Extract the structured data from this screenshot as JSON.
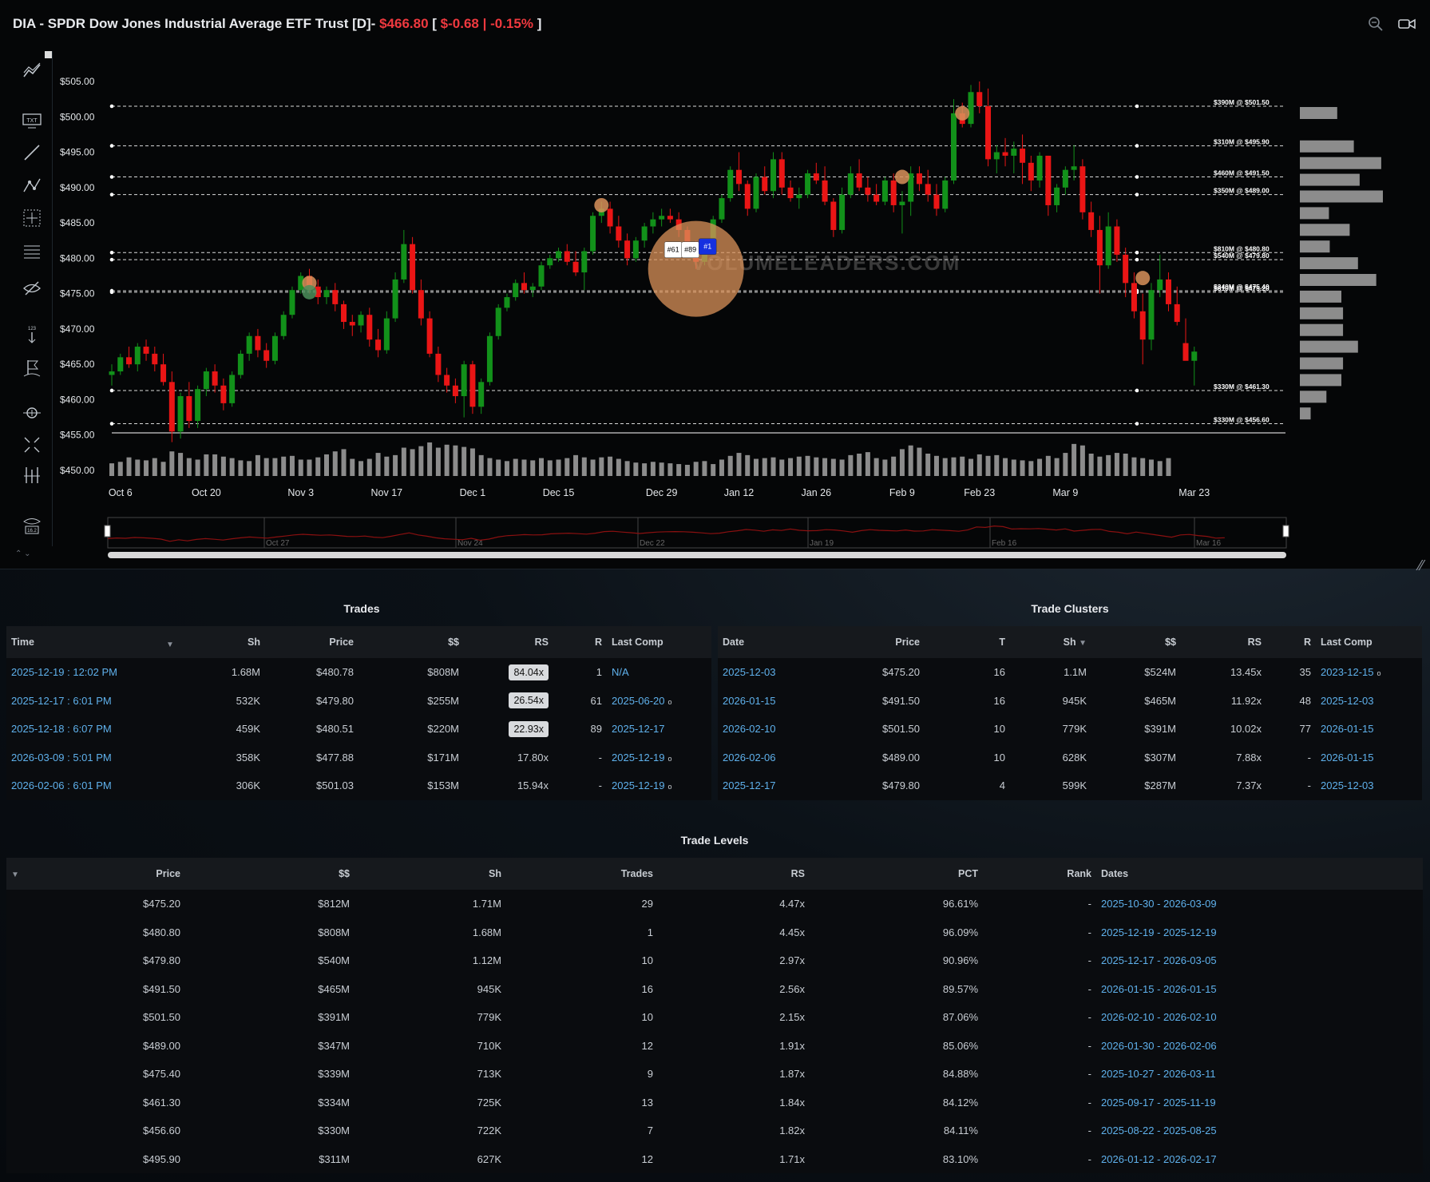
{
  "chart": {
    "title": "DIA - SPDR Dow Jones Industrial Average ETF Trust [D]-",
    "price": "$466.80",
    "change_open": "[",
    "change": "$-0.68 | -0.15%",
    "change_close": "]",
    "watermark": "VOLUMELEADERS.COM",
    "colors": {
      "up": "#12911a",
      "down": "#ea1515",
      "level": "#ffffff",
      "volume": "#8c8c8c",
      "bubble": "#d9925a",
      "accent_red": "#f0393f",
      "link": "#5fb1ec"
    }
  },
  "toolbar": {
    "icons": [
      "indicators-icon",
      "text-icon",
      "line-icon",
      "pattern-icon",
      "crosshair-box-icon",
      "fib-icon",
      "hide-icon",
      "measure-icon",
      "flag-icon",
      "zoom-icon",
      "fullscreen-icon",
      "levels-icon",
      "eye-count-icon"
    ],
    "eye_count": "16.2"
  },
  "chart_data": {
    "type": "candlestick",
    "y_ticks": [
      "$505.00",
      "$500.00",
      "$495.00",
      "$490.00",
      "$485.00",
      "$480.00",
      "$475.00",
      "$470.00",
      "$465.00",
      "$460.00",
      "$455.00",
      "$450.00"
    ],
    "ylim": [
      450,
      505
    ],
    "x_ticks": [
      {
        "label": "Oct 6",
        "i": 1
      },
      {
        "label": "Oct 20",
        "i": 11
      },
      {
        "label": "Nov 3",
        "i": 22
      },
      {
        "label": "Nov 17",
        "i": 32
      },
      {
        "label": "Dec 1",
        "i": 42
      },
      {
        "label": "Dec 15",
        "i": 52
      },
      {
        "label": "Dec 29",
        "i": 64
      },
      {
        "label": "Jan 12",
        "i": 73
      },
      {
        "label": "Jan 26",
        "i": 82
      },
      {
        "label": "Feb 9",
        "i": 92
      },
      {
        "label": "Feb 23",
        "i": 101
      },
      {
        "label": "Mar 9",
        "i": 111
      },
      {
        "label": "Mar 23",
        "i": 126
      }
    ],
    "candles": [
      [
        463.5,
        465,
        462,
        464
      ],
      [
        464,
        466.5,
        463.5,
        466
      ],
      [
        466,
        467.5,
        464.5,
        465
      ],
      [
        465,
        468,
        464,
        467.5
      ],
      [
        467.5,
        468.5,
        465.5,
        466.5
      ],
      [
        466.5,
        467.5,
        464,
        465
      ],
      [
        465,
        466.5,
        462,
        462.5
      ],
      [
        462.5,
        464,
        454,
        455.5
      ],
      [
        455.5,
        461,
        454.5,
        460.5
      ],
      [
        460.5,
        462.5,
        456,
        457
      ],
      [
        457,
        462,
        456,
        461.5
      ],
      [
        461.5,
        464.5,
        460.5,
        464
      ],
      [
        464,
        465,
        461,
        462
      ],
      [
        462,
        463,
        458.5,
        459.5
      ],
      [
        459.5,
        464,
        459,
        463.5
      ],
      [
        463.5,
        467,
        463,
        466.5
      ],
      [
        466.5,
        469.5,
        465.5,
        469
      ],
      [
        469,
        470,
        466,
        467
      ],
      [
        467,
        468,
        464.5,
        465.5
      ],
      [
        465.5,
        469.5,
        465,
        469
      ],
      [
        469,
        472.5,
        468.5,
        472
      ],
      [
        472,
        476,
        471.5,
        475.5
      ],
      [
        475.5,
        478,
        475,
        477.5
      ],
      [
        477.5,
        478.5,
        475,
        476
      ],
      [
        476,
        477,
        473.5,
        474.5
      ],
      [
        474.5,
        476,
        473.5,
        475.5
      ],
      [
        475.5,
        476.5,
        472.5,
        473.5
      ],
      [
        473.5,
        474,
        470,
        471
      ],
      [
        471,
        472,
        469,
        470.5
      ],
      [
        470.5,
        472.5,
        469.5,
        472
      ],
      [
        472,
        473,
        467.5,
        468.5
      ],
      [
        468.5,
        470,
        466,
        467
      ],
      [
        467,
        472.5,
        466.5,
        471.5
      ],
      [
        471.5,
        478,
        471,
        477
      ],
      [
        477,
        484,
        476.5,
        482
      ],
      [
        482,
        483,
        475,
        475.5
      ],
      [
        475.5,
        477,
        470.5,
        471.5
      ],
      [
        471.5,
        472.5,
        466,
        466.5
      ],
      [
        466.5,
        467.5,
        462.5,
        463.5
      ],
      [
        463.5,
        464.5,
        461,
        462
      ],
      [
        462,
        463,
        459.5,
        460.5
      ],
      [
        460.5,
        465.5,
        457.5,
        465
      ],
      [
        465,
        465.5,
        458,
        459
      ],
      [
        459,
        463,
        458,
        462.5
      ],
      [
        462.5,
        469.5,
        462,
        469
      ],
      [
        469,
        473.5,
        468.5,
        473
      ],
      [
        473,
        475,
        472.5,
        474.5
      ],
      [
        474.5,
        477,
        474,
        476.5
      ],
      [
        476.5,
        478,
        475,
        475.5
      ],
      [
        475.5,
        476.5,
        474.5,
        476
      ],
      [
        476,
        479.5,
        475.5,
        479
      ],
      [
        479,
        480.5,
        478.5,
        480
      ],
      [
        480,
        481.5,
        479.5,
        481
      ],
      [
        481,
        482,
        479,
        479.5
      ],
      [
        479.5,
        481,
        477.5,
        478
      ],
      [
        478,
        481.5,
        475.5,
        481
      ],
      [
        481,
        486.5,
        480.5,
        486
      ],
      [
        486,
        488,
        485,
        487
      ],
      [
        487,
        488,
        483.5,
        484.5
      ],
      [
        484.5,
        486,
        481.5,
        482.5
      ],
      [
        482.5,
        483.5,
        479,
        480
      ],
      [
        480,
        483,
        479.5,
        482.5
      ],
      [
        482.5,
        485,
        481.5,
        484.5
      ],
      [
        484.5,
        486.5,
        483.5,
        485.5
      ],
      [
        485.5,
        487,
        484.5,
        486
      ],
      [
        486,
        487,
        485,
        485.5
      ],
      [
        485.5,
        486.5,
        483,
        484
      ],
      [
        484,
        484.5,
        481,
        482
      ],
      [
        482,
        482.5,
        478.5,
        479.5
      ],
      [
        479.5,
        481.5,
        479,
        481
      ],
      [
        481,
        486,
        480.5,
        485.5
      ],
      [
        485.5,
        489,
        485,
        488.5
      ],
      [
        488.5,
        493,
        488,
        492.5
      ],
      [
        492.5,
        495,
        489.5,
        490.5
      ],
      [
        490.5,
        491,
        486,
        487
      ],
      [
        487,
        492,
        486.5,
        491.5
      ],
      [
        491.5,
        493,
        489,
        489.5
      ],
      [
        489.5,
        495,
        488.5,
        494
      ],
      [
        494,
        495,
        489,
        490
      ],
      [
        490,
        491,
        488,
        488.5
      ],
      [
        488.5,
        490,
        487,
        489
      ],
      [
        489,
        492.5,
        488.5,
        492
      ],
      [
        492,
        493.5,
        490.5,
        491
      ],
      [
        491,
        493,
        487.5,
        488
      ],
      [
        488,
        488.5,
        483,
        484
      ],
      [
        484,
        490,
        483.5,
        489
      ],
      [
        489,
        493,
        488.5,
        492
      ],
      [
        492,
        494,
        489.5,
        490
      ],
      [
        490,
        491.5,
        488,
        489
      ],
      [
        489,
        490.5,
        487.5,
        488
      ],
      [
        488,
        491.5,
        487.5,
        491
      ],
      [
        491,
        492,
        486.5,
        487.5
      ],
      [
        487.5,
        489.5,
        483.5,
        488
      ],
      [
        488,
        493,
        486,
        492
      ],
      [
        492,
        493,
        489.5,
        490.5
      ],
      [
        490.5,
        492.5,
        488,
        489
      ],
      [
        489,
        490.5,
        486,
        487
      ],
      [
        487,
        491.5,
        486.5,
        491
      ],
      [
        491,
        502.5,
        490.5,
        500.5
      ],
      [
        500.5,
        502,
        498.5,
        499
      ],
      [
        499,
        504.5,
        498.5,
        503.5
      ],
      [
        503.5,
        505,
        500.5,
        501.5
      ],
      [
        501.5,
        504,
        493,
        494
      ],
      [
        494,
        496,
        492,
        495
      ],
      [
        495,
        497,
        493,
        494.5
      ],
      [
        494.5,
        496.5,
        492,
        495.5
      ],
      [
        495.5,
        497.5,
        490.5,
        493.5
      ],
      [
        493.5,
        494.5,
        489.5,
        491
      ],
      [
        491,
        495,
        490,
        494.5
      ],
      [
        494.5,
        494.5,
        486,
        487.5
      ],
      [
        487.5,
        490.5,
        486.5,
        490
      ],
      [
        490,
        493,
        489,
        492.5
      ],
      [
        492.5,
        496,
        491,
        493
      ],
      [
        493,
        494,
        485.5,
        486.5
      ],
      [
        486.5,
        488,
        483,
        484
      ],
      [
        484,
        486,
        475,
        479
      ],
      [
        479,
        486.5,
        478.5,
        484.5
      ],
      [
        484.5,
        485.5,
        479.5,
        480.5
      ],
      [
        480.5,
        481.5,
        474.5,
        476.5
      ],
      [
        476.5,
        478,
        471.5,
        472.5
      ],
      [
        472.5,
        475,
        465,
        468.5
      ],
      [
        468.5,
        476.5,
        467,
        475.5
      ],
      [
        475.5,
        480.5,
        474.5,
        477
      ],
      [
        477,
        478,
        472.5,
        473.5
      ],
      [
        473.5,
        476,
        470.5,
        471
      ],
      [
        468,
        471.5,
        466,
        465.5
      ],
      [
        465.5,
        467.5,
        462,
        466.8
      ]
    ],
    "volume": [
      17,
      19,
      25,
      22,
      21,
      24,
      19,
      33,
      31,
      24,
      22,
      29,
      29,
      26,
      24,
      21,
      20,
      28,
      24,
      24,
      26,
      27,
      22,
      22,
      25,
      29,
      33,
      36,
      23,
      20,
      23,
      31,
      26,
      28,
      38,
      36,
      40,
      45,
      38,
      42,
      41,
      39,
      37,
      28,
      24,
      22,
      20,
      23,
      22,
      21,
      24,
      21,
      22,
      24,
      28,
      25,
      22,
      25,
      26,
      23,
      20,
      18,
      17,
      19,
      18,
      17,
      16,
      15,
      19,
      20,
      16,
      22,
      27,
      31,
      28,
      23,
      24,
      25,
      22,
      24,
      26,
      27,
      25,
      24,
      23,
      22,
      28,
      30,
      32,
      24,
      22,
      26,
      36,
      41,
      38,
      30,
      27,
      24,
      25,
      26,
      23,
      29,
      27,
      28,
      24,
      22,
      21,
      20,
      23,
      27,
      24,
      31,
      43,
      41,
      30,
      26,
      28,
      31,
      30,
      25,
      24,
      22,
      20,
      24
    ],
    "levels": [
      {
        "price": 501.5,
        "label": "$390M @ $501.50"
      },
      {
        "price": 495.9,
        "label": "$310M @ $495.90"
      },
      {
        "price": 491.5,
        "label": "$460M @ $491.50"
      },
      {
        "price": 489.0,
        "label": "$350M @ $489.00"
      },
      {
        "price": 480.8,
        "label": "$810M @ $480.80"
      },
      {
        "price": 479.8,
        "label": "$540M @ $479.80"
      },
      {
        "price": 475.4,
        "label": "$340M @ $475.40"
      },
      {
        "price": 475.2,
        "label": "$810M @ $475.20"
      },
      {
        "price": 461.3,
        "label": "$330M @ $461.30"
      },
      {
        "price": 456.6,
        "label": "$330M @ $456.60"
      }
    ],
    "bubbles": [
      {
        "i": 23,
        "price": 476.5
      },
      {
        "i": 23,
        "price": 475.2,
        "green": true
      },
      {
        "i": 57,
        "price": 487.5
      },
      {
        "i": 68,
        "price": 478.5,
        "big": true
      },
      {
        "i": 99,
        "price": 500.5
      },
      {
        "i": 92,
        "price": 491.5
      },
      {
        "i": 120,
        "price": 477.2
      }
    ],
    "trade_flags": [
      {
        "label": "#61",
        "i": 66
      },
      {
        "label": "#89",
        "i": 68
      },
      {
        "label": "#1",
        "i": 70
      }
    ],
    "profile_bars": [
      0.45,
      0,
      0.65,
      0.98,
      0.72,
      1.0,
      0.35,
      0.6,
      0.36,
      0.7,
      0.92,
      0.5,
      0.52,
      0.52,
      0.7,
      0.52,
      0.5,
      0.32,
      0.13
    ],
    "navigator_ticks": [
      "Oct 27",
      "Nov 24",
      "Dec 22",
      "Jan 19",
      "Feb 16",
      "Mar 16"
    ]
  },
  "trades": {
    "title": "Trades",
    "columns": [
      "Time",
      "Sh",
      "Price",
      "$$",
      "RS",
      "R",
      "Last Comp"
    ],
    "rows": [
      {
        "time": "2025-12-19 : 12:02 PM",
        "sh": "1.68M",
        "price": "$480.78",
        "dollars": "$808M",
        "rs": "84.04x",
        "chip": true,
        "r": "1",
        "last": "N/A",
        "dot": false
      },
      {
        "time": "2025-12-17 : 6:01 PM",
        "sh": "532K",
        "price": "$479.80",
        "dollars": "$255M",
        "rs": "26.54x",
        "chip": true,
        "r": "61",
        "last": "2025-06-20",
        "dot": true
      },
      {
        "time": "2025-12-18 : 6:07 PM",
        "sh": "459K",
        "price": "$480.51",
        "dollars": "$220M",
        "rs": "22.93x",
        "chip": true,
        "r": "89",
        "last": "2025-12-17",
        "dot": false
      },
      {
        "time": "2026-03-09 : 5:01 PM",
        "sh": "358K",
        "price": "$477.88",
        "dollars": "$171M",
        "rs": "17.80x",
        "chip": false,
        "r": "-",
        "last": "2025-12-19",
        "dot": true
      },
      {
        "time": "2026-02-06 : 6:01 PM",
        "sh": "306K",
        "price": "$501.03",
        "dollars": "$153M",
        "rs": "15.94x",
        "chip": false,
        "r": "-",
        "last": "2025-12-19",
        "dot": true
      }
    ]
  },
  "clusters": {
    "title": "Trade Clusters",
    "columns": [
      "Date",
      "Price",
      "T",
      "Sh",
      "$$",
      "RS",
      "R",
      "Last Comp"
    ],
    "rows": [
      {
        "date": "2025-12-03",
        "price": "$475.20",
        "t": "16",
        "sh": "1.1M",
        "dollars": "$524M",
        "rs": "13.45x",
        "r": "35",
        "last": "2023-12-15",
        "dot": true
      },
      {
        "date": "2026-01-15",
        "price": "$491.50",
        "t": "16",
        "sh": "945K",
        "dollars": "$465M",
        "rs": "11.92x",
        "r": "48",
        "last": "2025-12-03",
        "dot": false
      },
      {
        "date": "2026-02-10",
        "price": "$501.50",
        "t": "10",
        "sh": "779K",
        "dollars": "$391M",
        "rs": "10.02x",
        "r": "77",
        "last": "2026-01-15",
        "dot": false
      },
      {
        "date": "2026-02-06",
        "price": "$489.00",
        "t": "10",
        "sh": "628K",
        "dollars": "$307M",
        "rs": "7.88x",
        "r": "-",
        "last": "2026-01-15",
        "dot": false
      },
      {
        "date": "2025-12-17",
        "price": "$479.80",
        "t": "4",
        "sh": "599K",
        "dollars": "$287M",
        "rs": "7.37x",
        "r": "-",
        "last": "2025-12-03",
        "dot": false
      }
    ]
  },
  "levels_table": {
    "title": "Trade Levels",
    "columns": [
      "Price",
      "$$",
      "Sh",
      "Trades",
      "RS",
      "PCT",
      "Rank",
      "Dates"
    ],
    "rows": [
      {
        "price": "$475.20",
        "dollars": "$812M",
        "sh": "1.71M",
        "trades": "29",
        "rs": "4.47x",
        "pct": "96.61%",
        "rank": "-",
        "dates": "2025-10-30 - 2026-03-09"
      },
      {
        "price": "$480.80",
        "dollars": "$808M",
        "sh": "1.68M",
        "trades": "1",
        "rs": "4.45x",
        "pct": "96.09%",
        "rank": "-",
        "dates": "2025-12-19 - 2025-12-19"
      },
      {
        "price": "$479.80",
        "dollars": "$540M",
        "sh": "1.12M",
        "trades": "10",
        "rs": "2.97x",
        "pct": "90.96%",
        "rank": "-",
        "dates": "2025-12-17 - 2026-03-05"
      },
      {
        "price": "$491.50",
        "dollars": "$465M",
        "sh": "945K",
        "trades": "16",
        "rs": "2.56x",
        "pct": "89.57%",
        "rank": "-",
        "dates": "2026-01-15 - 2026-01-15"
      },
      {
        "price": "$501.50",
        "dollars": "$391M",
        "sh": "779K",
        "trades": "10",
        "rs": "2.15x",
        "pct": "87.06%",
        "rank": "-",
        "dates": "2026-02-10 - 2026-02-10"
      },
      {
        "price": "$489.00",
        "dollars": "$347M",
        "sh": "710K",
        "trades": "12",
        "rs": "1.91x",
        "pct": "85.06%",
        "rank": "-",
        "dates": "2026-01-30 - 2026-02-06"
      },
      {
        "price": "$475.40",
        "dollars": "$339M",
        "sh": "713K",
        "trades": "9",
        "rs": "1.87x",
        "pct": "84.88%",
        "rank": "-",
        "dates": "2025-10-27 - 2026-03-11"
      },
      {
        "price": "$461.30",
        "dollars": "$334M",
        "sh": "725K",
        "trades": "13",
        "rs": "1.84x",
        "pct": "84.12%",
        "rank": "-",
        "dates": "2025-09-17 - 2025-11-19"
      },
      {
        "price": "$456.60",
        "dollars": "$330M",
        "sh": "722K",
        "trades": "7",
        "rs": "1.82x",
        "pct": "84.11%",
        "rank": "-",
        "dates": "2025-08-22 - 2025-08-25"
      },
      {
        "price": "$495.90",
        "dollars": "$311M",
        "sh": "627K",
        "trades": "12",
        "rs": "1.71x",
        "pct": "83.10%",
        "rank": "-",
        "dates": "2026-01-12 - 2026-02-17"
      }
    ]
  }
}
